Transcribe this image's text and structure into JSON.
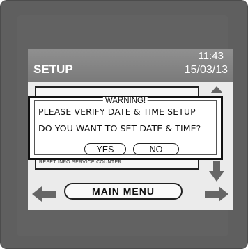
{
  "header": {
    "title": "SETUP",
    "time": "11:43",
    "date": "15/03/13"
  },
  "dialog": {
    "heading": "WARNING!",
    "line1": "PLEASE VERIFY DATE & TIME SETUP",
    "line2": "DO YOU WANT TO SET DATE & TIME?",
    "yes_label": "YES",
    "no_label": "NO"
  },
  "footer": {
    "main_menu_label": "MAIN MENU"
  },
  "background_text": "RESET INFO SERVICE COUNTER",
  "colors": {
    "screen_bg": "#ebebeb",
    "header_bg": "#858585",
    "bezel": "#5f5f5f",
    "arrow": "#666666"
  },
  "icons": [
    "arrow-up-icon",
    "arrow-down-icon",
    "arrow-left-icon",
    "arrow-right-icon"
  ]
}
